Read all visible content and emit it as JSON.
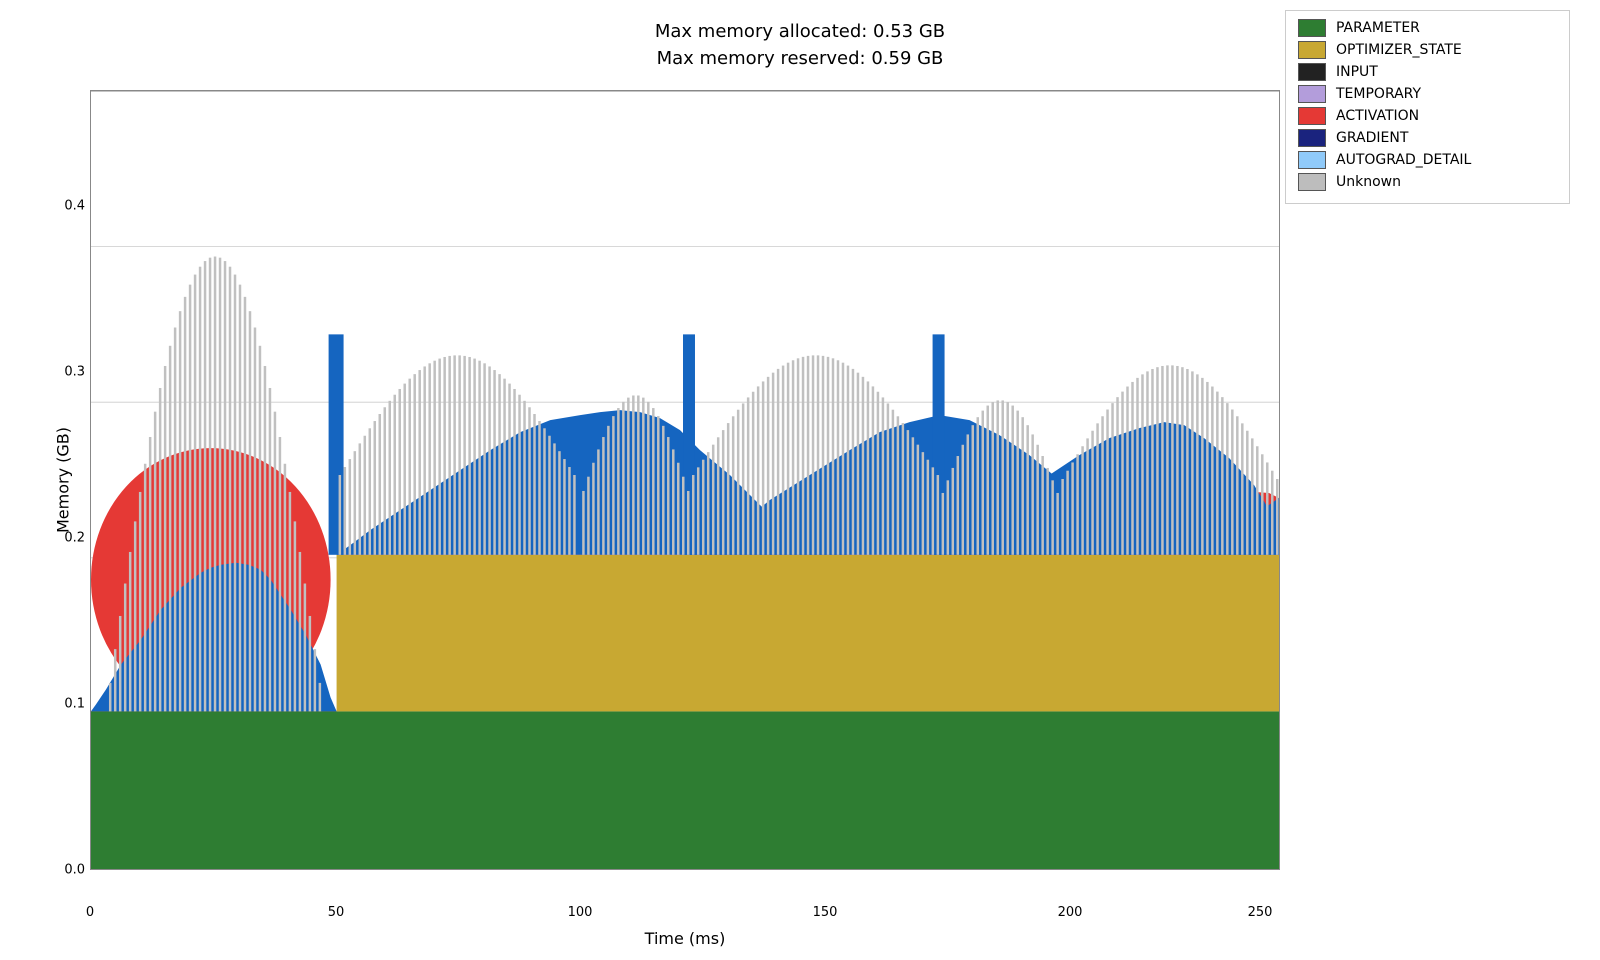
{
  "title": {
    "line1": "Max memory allocated: 0.53 GB",
    "line2": "Max memory reserved: 0.59 GB"
  },
  "axes": {
    "y_label": "Memory (GB)",
    "x_label": "Time (ms)",
    "y_ticks": [
      "0.0",
      "0.1",
      "0.2",
      "0.3",
      "0.4"
    ],
    "x_ticks": [
      "0",
      "50",
      "100",
      "150",
      "200",
      "250"
    ]
  },
  "legend": {
    "items": [
      {
        "label": "PARAMETER",
        "color": "#2e7d32"
      },
      {
        "label": "OPTIMIZER_STATE",
        "color": "#c8a832"
      },
      {
        "label": "INPUT",
        "color": "#222222"
      },
      {
        "label": "TEMPORARY",
        "color": "#b39ddb"
      },
      {
        "label": "ACTIVATION",
        "color": "#e53935"
      },
      {
        "label": "GRADIENT",
        "color": "#1a237e"
      },
      {
        "label": "AUTOGRAD_DETAIL",
        "color": "#90caf9"
      },
      {
        "label": "Unknown",
        "color": "#bdbdbd"
      }
    ]
  }
}
